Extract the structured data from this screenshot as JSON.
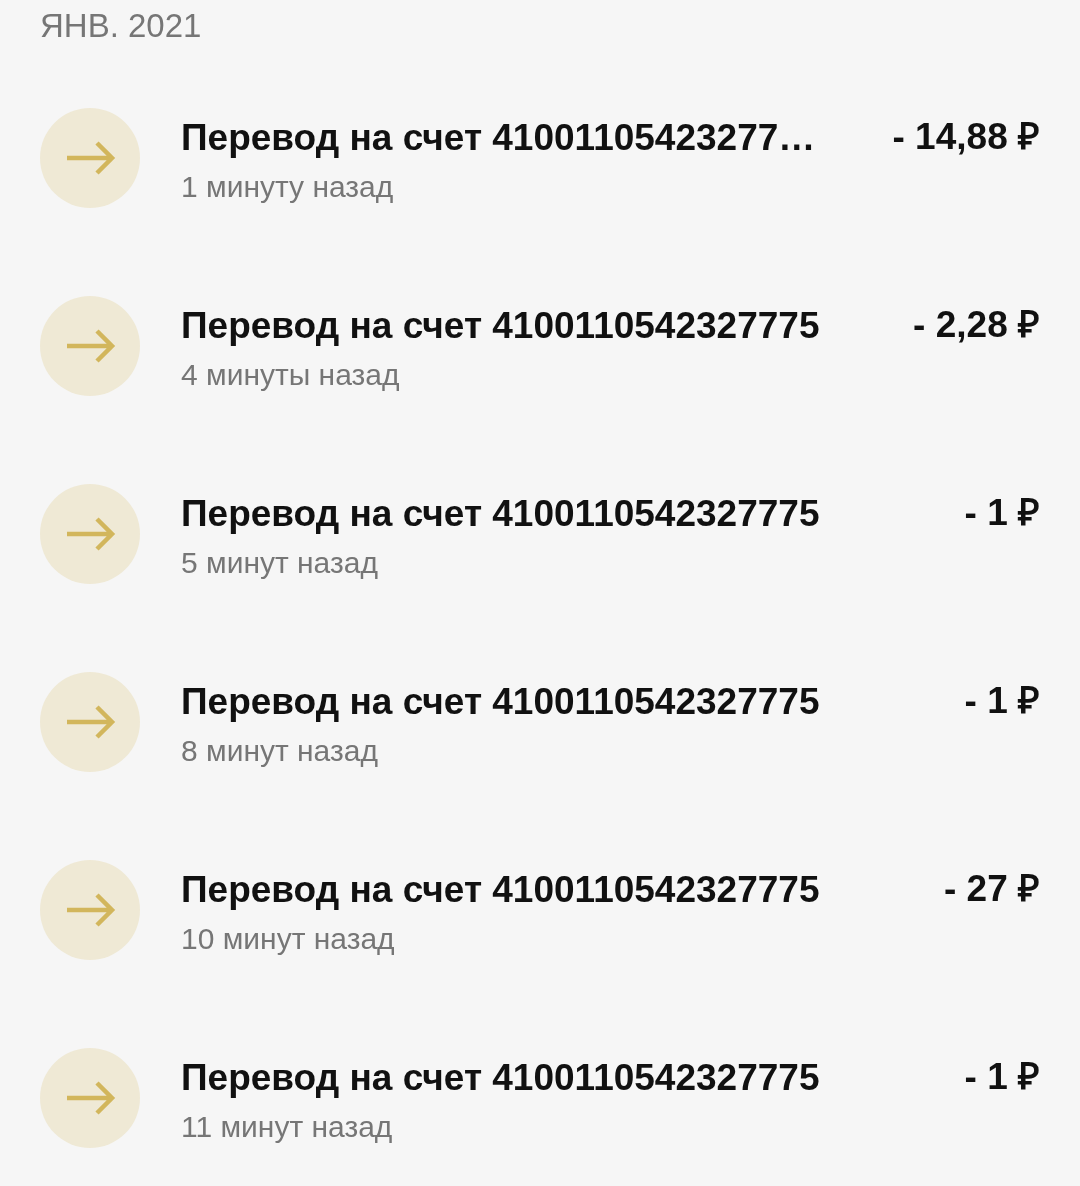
{
  "header": {
    "month": "ЯНВ. 2021"
  },
  "transactions": [
    {
      "title": "Перевод на счет 41001105423277…",
      "time": "1 минуту назад",
      "amount": "- 14,88 ₽"
    },
    {
      "title": "Перевод на счет 4100110542327775",
      "time": "4 минуты назад",
      "amount": "- 2,28 ₽"
    },
    {
      "title": "Перевод на счет 4100110542327775",
      "time": "5 минут назад",
      "amount": "- 1 ₽"
    },
    {
      "title": "Перевод на счет 4100110542327775",
      "time": "8 минут назад",
      "amount": "- 1 ₽"
    },
    {
      "title": "Перевод на счет 4100110542327775",
      "time": "10 минут назад",
      "amount": "- 27 ₽"
    },
    {
      "title": "Перевод на счет 4100110542327775",
      "time": "11 минут назад",
      "amount": "- 1 ₽"
    }
  ]
}
